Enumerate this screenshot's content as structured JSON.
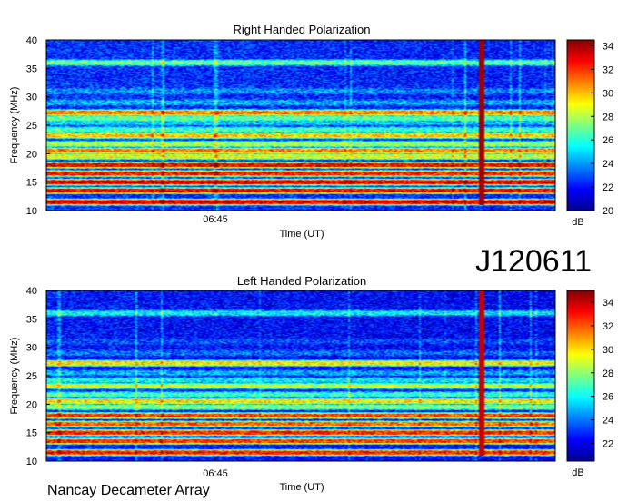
{
  "observation_id": "J120611",
  "instrument": "Nancay Decameter Array",
  "colors": {
    "colormap": [
      "#00008f",
      "#0000ff",
      "#007fff",
      "#00ffff",
      "#7fff7f",
      "#ffff00",
      "#ff7f00",
      "#ff0000",
      "#7f0000"
    ],
    "axis": "#000000",
    "background": "#ffffff"
  },
  "chart_data": [
    {
      "type": "heatmap",
      "title": "Right Handed Polarization",
      "xlabel": "Time (UT)",
      "ylabel": "Frequency (MHz)",
      "x_tick_labels": [
        "06:45"
      ],
      "ylim": [
        10,
        40
      ],
      "y_ticks": [
        10,
        15,
        20,
        25,
        30,
        35,
        40
      ],
      "colorbar": {
        "label": "dB",
        "range": [
          20,
          34.5
        ],
        "ticks": [
          20,
          22,
          24,
          26,
          28,
          30,
          32,
          34
        ]
      },
      "background_level_db": 22.5,
      "bands": [
        {
          "freq_mhz": 10.5,
          "level_db": 20.5
        },
        {
          "freq_mhz": 11.5,
          "level_db": 33.5
        },
        {
          "freq_mhz": 12.5,
          "level_db": 21.5
        },
        {
          "freq_mhz": 13.5,
          "level_db": 33
        },
        {
          "freq_mhz": 15,
          "level_db": 33.5
        },
        {
          "freq_mhz": 16.5,
          "level_db": 32.5
        },
        {
          "freq_mhz": 18,
          "level_db": 33
        },
        {
          "freq_mhz": 19.5,
          "level_db": 29
        },
        {
          "freq_mhz": 20.5,
          "level_db": 31
        },
        {
          "freq_mhz": 21.7,
          "level_db": 28
        },
        {
          "freq_mhz": 23.2,
          "level_db": 30
        },
        {
          "freq_mhz": 24.2,
          "level_db": 26.5
        },
        {
          "freq_mhz": 25.5,
          "level_db": 25
        },
        {
          "freq_mhz": 26.2,
          "level_db": 27
        },
        {
          "freq_mhz": 27.2,
          "level_db": 31
        },
        {
          "freq_mhz": 29,
          "level_db": 24.5
        },
        {
          "freq_mhz": 31,
          "level_db": 24
        },
        {
          "freq_mhz": 36,
          "level_db": 27
        }
      ],
      "burst": {
        "name": "vertical-burst",
        "time_fraction": 0.852,
        "freq_range_mhz": [
          11,
          40
        ],
        "level_db": 34
      }
    },
    {
      "type": "heatmap",
      "title": "Left Handed Polarization",
      "xlabel": "Time (UT)",
      "ylabel": "Frequency (MHz)",
      "x_tick_labels": [
        "06:45"
      ],
      "ylim": [
        10,
        40
      ],
      "y_ticks": [
        10,
        15,
        20,
        25,
        30,
        35,
        40
      ],
      "colorbar": {
        "label": "dB",
        "range": [
          20.5,
          35
        ],
        "ticks": [
          22,
          24,
          26,
          28,
          30,
          32,
          34
        ]
      },
      "background_level_db": 22.5,
      "bands": [
        {
          "freq_mhz": 10.5,
          "level_db": 21
        },
        {
          "freq_mhz": 11.5,
          "level_db": 33
        },
        {
          "freq_mhz": 12.5,
          "level_db": 22
        },
        {
          "freq_mhz": 13.5,
          "level_db": 32.5
        },
        {
          "freq_mhz": 15,
          "level_db": 33
        },
        {
          "freq_mhz": 16.5,
          "level_db": 32
        },
        {
          "freq_mhz": 18,
          "level_db": 32.5
        },
        {
          "freq_mhz": 19.5,
          "level_db": 28
        },
        {
          "freq_mhz": 20.5,
          "level_db": 30
        },
        {
          "freq_mhz": 21.7,
          "level_db": 27
        },
        {
          "freq_mhz": 23.2,
          "level_db": 29
        },
        {
          "freq_mhz": 24.2,
          "level_db": 26
        },
        {
          "freq_mhz": 25.5,
          "level_db": 25
        },
        {
          "freq_mhz": 27.2,
          "level_db": 30
        },
        {
          "freq_mhz": 29,
          "level_db": 24
        },
        {
          "freq_mhz": 31,
          "level_db": 23.5
        },
        {
          "freq_mhz": 36,
          "level_db": 26
        }
      ],
      "burst": {
        "name": "vertical-burst",
        "time_fraction": 0.852,
        "freq_range_mhz": [
          11,
          40
        ],
        "level_db": 34
      }
    }
  ]
}
